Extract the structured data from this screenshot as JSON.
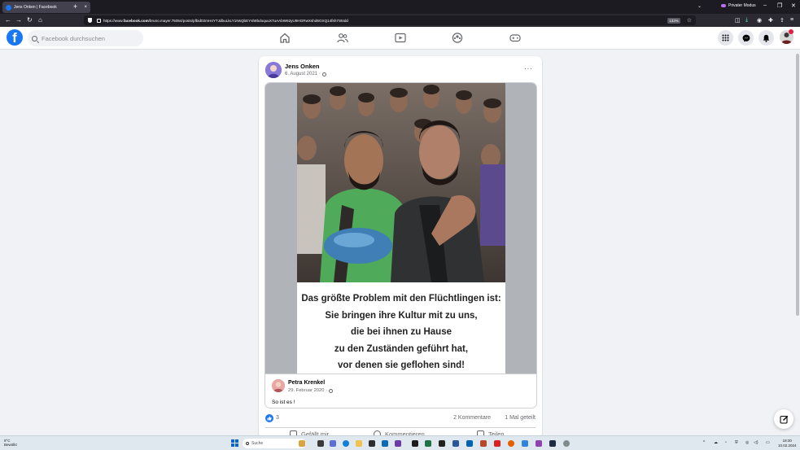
{
  "browser": {
    "tab_title": "Jens Onken | Facebook",
    "tab_close": "×",
    "new_tab": "+",
    "tabs_menu": "⌄",
    "private_mode": "Privater Modus",
    "url_prefix": "https://www.",
    "url_domain": "facebook.com",
    "url_path": "/bruno.mayer.75054/posts/pfbid02mH4YTJdbuLkLY1NsQbEYsh8bdoquuX7uAAbW62yU9HGRwXshd6GXQ14fsh7S5Idd",
    "zoom": "133%",
    "icons": {
      "back": "arrow-left-icon",
      "forward": "arrow-right-icon",
      "home": "home-icon",
      "star": "star-icon"
    }
  },
  "facebook": {
    "search_placeholder": "Facebook durchsuchen",
    "logo_letter": "f"
  },
  "post": {
    "author": "Jens Onken",
    "date": "6. August 2021 ·",
    "menu": "···",
    "image_text": [
      "Das größte Problem mit den Flüchtlingen ist:",
      "Sie bringen ihre Kultur mit zu uns,",
      "die bei ihnen zu Hause",
      "zu den Zuständen geführt hat,",
      "vor denen sie geflohen sind!"
    ],
    "shared_author": "Petra Krenkel",
    "shared_date": "29. Februar 2020 ·",
    "shared_caption": "So ist es !",
    "likes": "3",
    "comments": "2 Kommentare",
    "shares": "1 Mal geteilt",
    "actions": {
      "like": "Gefällt mir",
      "comment": "Kommentieren",
      "share": "Teilen"
    }
  },
  "taskbar": {
    "weather_temp": "9°C",
    "weather_desc": "Bewölkt",
    "search": "Suche",
    "time": "18:30",
    "date": "10.02.2024"
  },
  "colors": {
    "facebook_blue": "#1877f2",
    "chrome_dark": "#1c1b22",
    "page_bg": "#f0f2f5"
  }
}
